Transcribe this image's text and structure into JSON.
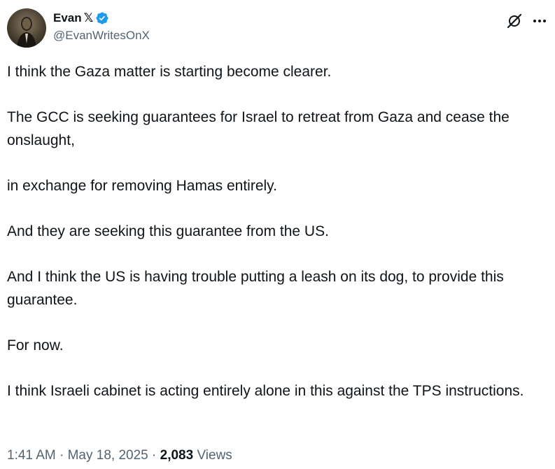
{
  "author": {
    "display_name": "Evan",
    "handle": "@EvanWritesOnX",
    "x_badge": "𝕏",
    "verified_color": "#1d9bf0"
  },
  "tweet": {
    "paragraphs": [
      "I think the Gaza matter is starting become clearer.",
      "The GCC is seeking guarantees for Israel to retreat from Gaza and cease the onslaught,",
      "in exchange for removing Hamas entirely.",
      "And they are seeking this guarantee from the US.",
      "And I think the US is having trouble putting a leash on its dog, to provide this guarantee.",
      "For now.",
      "I think Israeli cabinet is acting entirely alone in this against the TPS instructions."
    ]
  },
  "meta": {
    "time": "1:41 AM",
    "separator": "·",
    "date": "May 18, 2025",
    "views_count": "2,083",
    "views_label": "Views"
  },
  "icons": {
    "grok": "grok-icon",
    "more": "more-icon",
    "verified": "verified-badge-icon"
  }
}
